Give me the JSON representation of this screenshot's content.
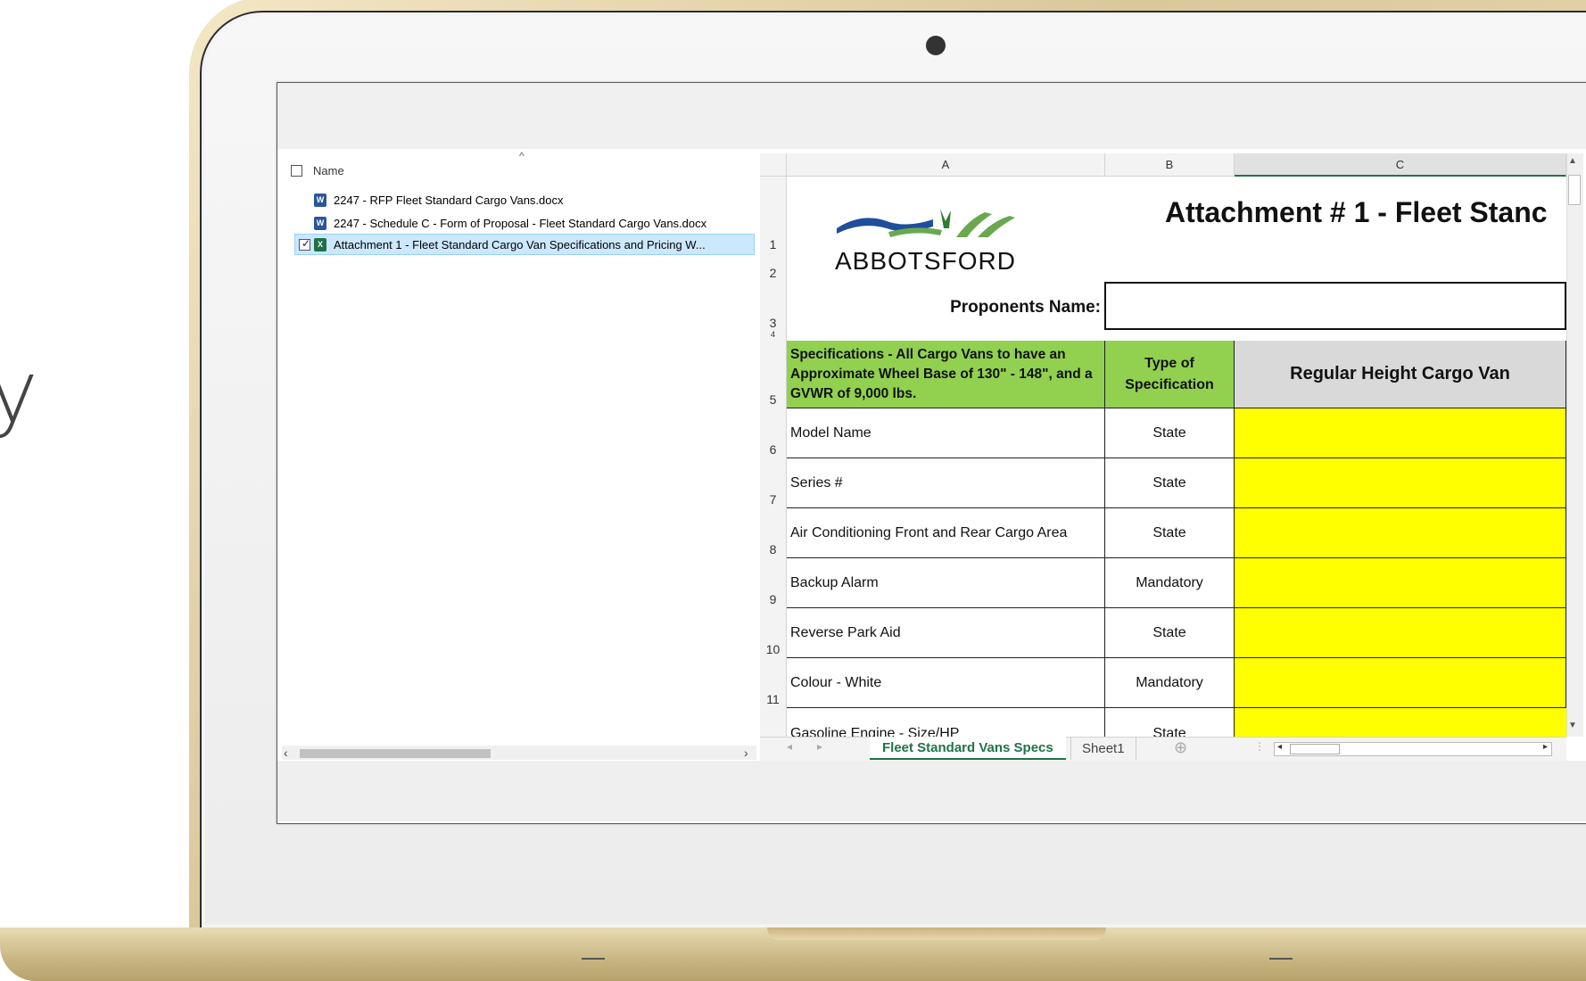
{
  "background": {
    "partial_text": "y"
  },
  "explorer": {
    "header_label": "Name",
    "sort_icon": "^",
    "files": [
      {
        "name": "2247 - RFP Fleet Standard Cargo Vans.docx",
        "type": "word",
        "selected": false
      },
      {
        "name": "2247 - Schedule C - Form of Proposal - Fleet Standard Cargo Vans.docx",
        "type": "word",
        "selected": false
      },
      {
        "name": "Attachment 1 - Fleet Standard Cargo Van Specifications and Pricing W...",
        "type": "excel",
        "selected": true
      }
    ]
  },
  "spreadsheet": {
    "columns": [
      "A",
      "B",
      "C"
    ],
    "logo_text": "ABBOTSFORD",
    "title": "Attachment # 1 - Fleet Stanc",
    "proponents_label": "Proponents Name:",
    "header_spec": "Specifications - All Cargo Vans to have an Approximate Wheel Base of 130\" - 148\", and a GVWR of 9,000 lbs.",
    "header_type": "Type of Specification",
    "header_van": "Regular Height Cargo Van",
    "row_numbers": [
      "1",
      "2",
      "3",
      "4",
      "5",
      "6",
      "7",
      "8",
      "9",
      "10",
      "11"
    ],
    "rows": [
      {
        "num": "6",
        "spec": "Model Name",
        "type": "State"
      },
      {
        "num": "7",
        "spec": "Series #",
        "type": "State"
      },
      {
        "num": "8",
        "spec": "Air Conditioning Front and Rear Cargo Area",
        "type": "State"
      },
      {
        "num": "9",
        "spec": "Backup Alarm",
        "type": "Mandatory"
      },
      {
        "num": "10",
        "spec": "Reverse Park Aid",
        "type": "State"
      },
      {
        "num": "11",
        "spec": "Colour  - White",
        "type": "Mandatory"
      },
      {
        "num": "",
        "spec": "Gasoline Engine  - Size/HP",
        "type": "State"
      }
    ],
    "tabs": {
      "active": "Fleet Standard Vans Specs",
      "other": "Sheet1",
      "add_symbol": "⊕"
    },
    "colors": {
      "green": "#92d050",
      "yellow": "#ffff00",
      "tab_green": "#217346"
    }
  }
}
